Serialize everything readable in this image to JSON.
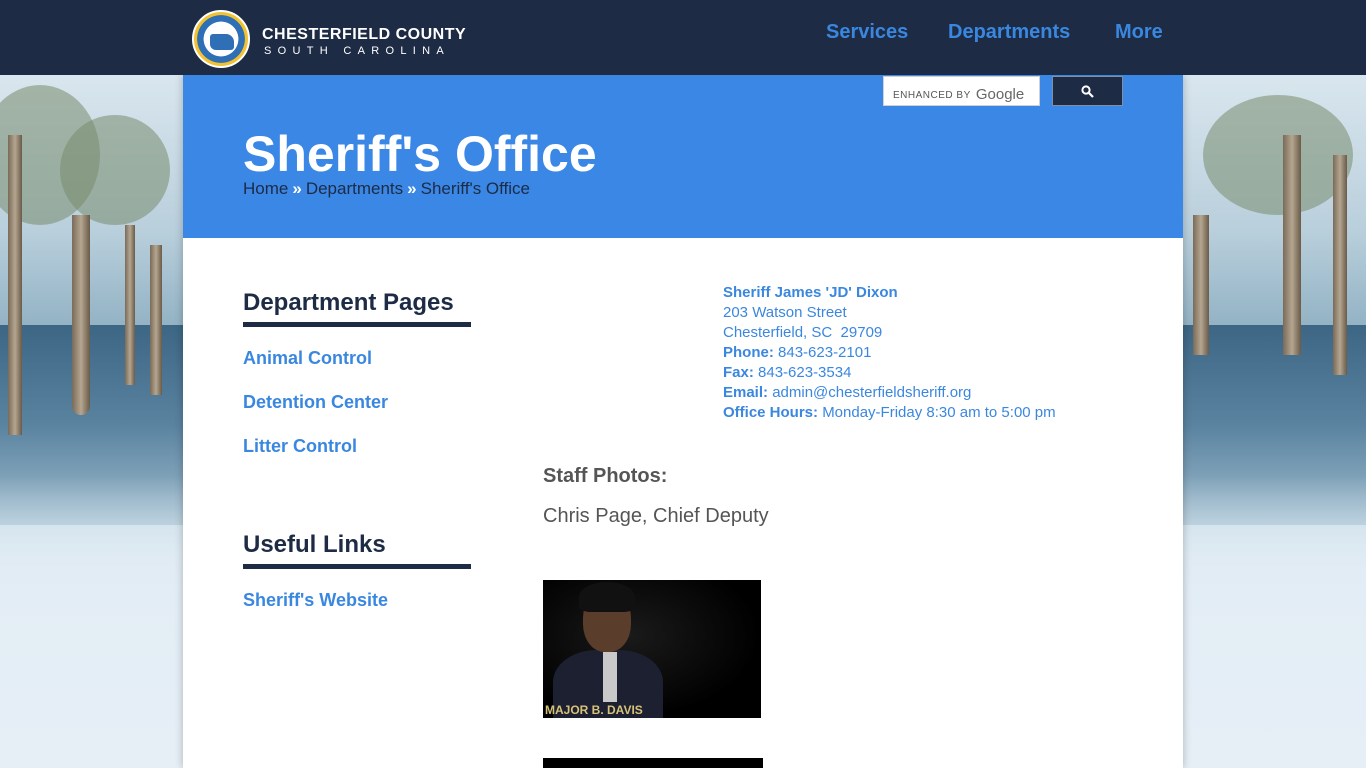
{
  "header": {
    "logo_title": "CHESTERFIELD COUNTY",
    "logo_subtitle": "SOUTH CAROLINA",
    "nav": [
      "Services",
      "Departments",
      "More"
    ]
  },
  "search": {
    "enhanced_label": "ENHANCED BY",
    "google_label": "Google",
    "button_icon": "search-icon"
  },
  "hero": {
    "title": "Sheriff's Office",
    "breadcrumb": [
      "Home",
      "Departments",
      "Sheriff's Office"
    ],
    "separator": "»"
  },
  "sidebar": {
    "department_heading": "Department Pages",
    "department_links": [
      "Animal Control",
      "Detention Center",
      "Litter Control"
    ],
    "useful_heading": "Useful Links",
    "useful_links": [
      "Sheriff's Website"
    ]
  },
  "contact": {
    "name": "Sheriff James 'JD' Dixon",
    "street": "203 Watson Street",
    "city": "Chesterfield, SC  29709",
    "phone_label": "Phone:",
    "phone": "843-623-2101",
    "fax_label": "Fax:",
    "fax": "843-623-3534",
    "email_label": "Email:",
    "email": "admin@chesterfieldsheriff.org",
    "hours_label": "Office Hours:",
    "hours": "Monday-Friday 8:30 am to 5:00 pm"
  },
  "staff": {
    "heading": "Staff Photos:",
    "caption": "Chris Page, Chief Deputy",
    "photo_label": "MAJOR B. DAVIS"
  },
  "colors": {
    "navy": "#1d2b45",
    "accent_blue": "#3a87e6",
    "link_blue": "#3a87e0"
  }
}
